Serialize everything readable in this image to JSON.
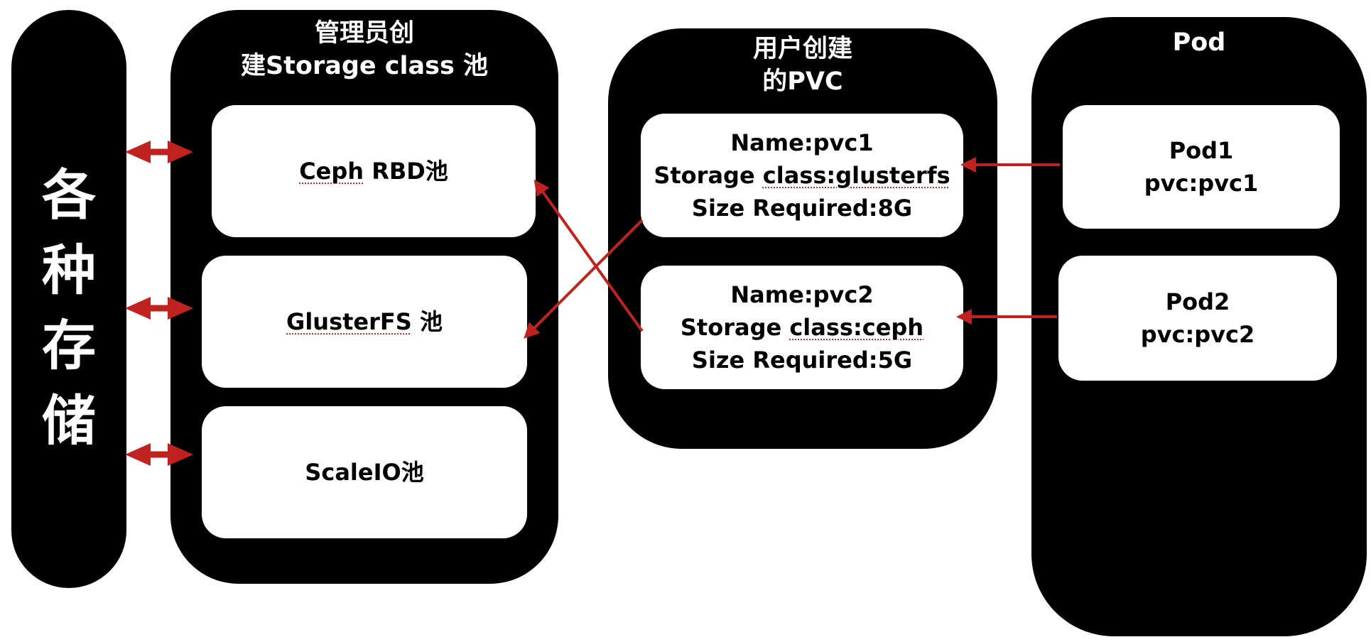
{
  "storage_column": {
    "chars": [
      "各",
      "种",
      "存",
      "储"
    ]
  },
  "pool_panel": {
    "title": "管理员创\n建Storage class 池",
    "pools": [
      {
        "prefix": "Ceph",
        "rest": " RBD池"
      },
      {
        "prefix": "GlusterFS",
        "rest": " 池"
      },
      {
        "prefix": "ScaleIO池",
        "rest": ""
      }
    ]
  },
  "pvc_panel": {
    "title": "用户创建\n的PVC",
    "pvcs": [
      {
        "name": "Name:pvc1",
        "class_prefix": "Storage ",
        "class_value": "class:glusterfs",
        "size": "Size Required:8G"
      },
      {
        "name": "Name:pvc2",
        "class_prefix": "Storage ",
        "class_value": "class:ceph",
        "size": "Size Required:5G"
      }
    ]
  },
  "pod_panel": {
    "title": "Pod",
    "pods": [
      {
        "name": "Pod1",
        "pvc": "pvc:pvc1"
      },
      {
        "name": "Pod2",
        "pvc": "pvc:pvc2"
      }
    ]
  },
  "colors": {
    "panel": "#000000",
    "card": "#ffffff",
    "arrow": "#c0231f",
    "spellcheck": "#e02020"
  }
}
